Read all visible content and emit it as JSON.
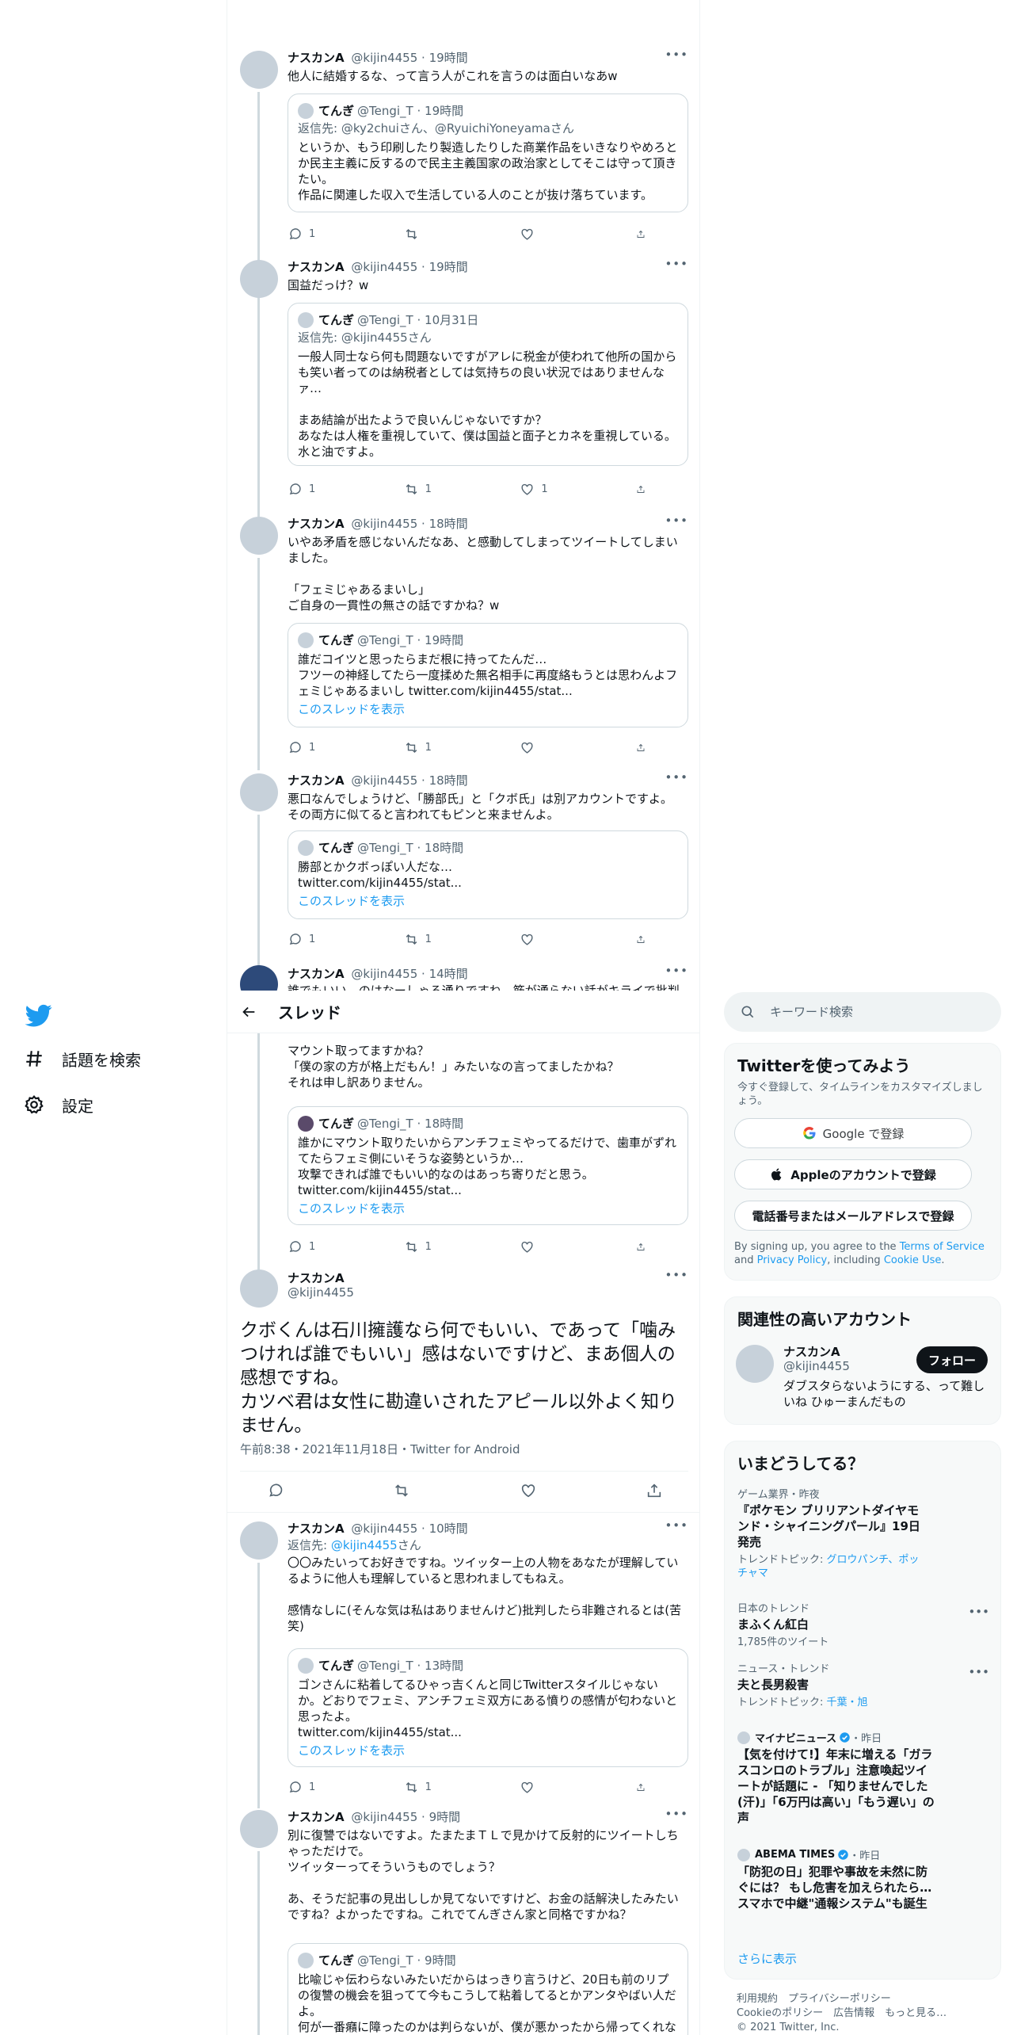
{
  "nav": {
    "explore": "話題を検索",
    "settings": "設定"
  },
  "header": {
    "title": "スレッド"
  },
  "tweets_top": [
    {
      "name": "ナスカンA",
      "handle": "@kijin4455",
      "time": "19時間",
      "text": "他人に結婚するな、って言う人がこれを言うのは面白いなあw",
      "quote": {
        "name": "てんぎ",
        "handle": "@Tengi_T",
        "time": "19時間",
        "reply": "返信先: @ky2chuiさん、@RyuichiYoneyamaさん",
        "text": "というか、もう印刷したり製造したりした商業作品をいきなりやめろとか民主主義に反するので民主主義国家の政治家としてそこは守って頂きたい。\n作品に関連した収入で生活している人のことが抜け落ちています。",
        "thread": ""
      },
      "counts": {
        "reply": "1",
        "retweet": "",
        "like": ""
      }
    },
    {
      "name": "ナスカンA",
      "handle": "@kijin4455",
      "time": "19時間",
      "text": "国益だっけ？w",
      "quote": {
        "name": "てんぎ",
        "handle": "@Tengi_T",
        "time": "10月31日",
        "reply": "返信先: @kijin4455さん",
        "text": "一般人同士なら何も問題ないですがアレに税金が使われて他所の国からも笑い者ってのは納税者としては気持ちの良い状況ではありませんなァ…\n\nまあ結論が出たようで良いんじゃないですか？\nあなたは人権を重視していて、僕は国益と面子とカネを重視している。\n水と油ですよ。",
        "thread": ""
      },
      "counts": {
        "reply": "1",
        "retweet": "1",
        "like": "1"
      }
    },
    {
      "name": "ナスカンA",
      "handle": "@kijin4455",
      "time": "18時間",
      "text": "いやあ矛盾を感じないんだなあ、と感動してしまってツイートしてしまいました。\n\n「フェミじゃあるまいし」\nご自身の一貫性の無さの話ですかね？w",
      "quote": {
        "name": "てんぎ",
        "handle": "@Tengi_T",
        "time": "19時間",
        "reply": "",
        "text": "誰だコイツと思ったらまだ根に持ってたんだ…\nフツーの神経してたら一度揉めた無名相手に再度絡もうとは思わんよフェミじゃあるまいし twitter.com/kijin4455/stat...",
        "thread": "このスレッドを表示"
      },
      "counts": {
        "reply": "1",
        "retweet": "1",
        "like": ""
      }
    },
    {
      "name": "ナスカンA",
      "handle": "@kijin4455",
      "time": "18時間",
      "text": "悪口なんでしょうけど、「勝部氏」と「クボ氏」は別アカウントですよ。\nその両方に似てると言われてもピンと来ませんよ。",
      "quote": {
        "name": "てんぎ",
        "handle": "@Tengi_T",
        "time": "18時間",
        "reply": "",
        "text": "勝部とかクボっぽい人だな…\ntwitter.com/kijin4455/stat...",
        "thread": "このスレッドを表示"
      },
      "counts": {
        "reply": "1",
        "retweet": "1",
        "like": ""
      }
    },
    {
      "name": "ナスカンA",
      "handle": "@kijin4455",
      "time": "14時間",
      "text": "誰でもいい、のはなーしゃる通りですね。筋が通らない話がキライで批判"
    }
  ],
  "tweet_partial": {
    "text": "マウント取ってますかね？\n「僕の家の方が格上だもん！」みたいなの言ってましたかね？\nそれは申し訳ありません。",
    "quote": {
      "name": "てんぎ",
      "handle": "@Tengi_T",
      "time": "18時間",
      "text": "誰かにマウント取りたいからアンチフェミやってるだけで、歯車がずれてたらフェミ側にいそうな姿勢というか…\n攻撃できれば誰でもいい的なのはあっち寄りだと思う。\ntwitter.com/kijin4455/stat...",
      "thread": "このスレッドを表示"
    },
    "counts": {
      "reply": "1",
      "retweet": "1",
      "like": ""
    }
  },
  "main_tweet": {
    "name": "ナスカンA",
    "handle": "@kijin4455",
    "text": "クボくんは石川擁護なら何でもいい、であって「噛みつければ誰でもいい」感はないですけど、まあ個人の感想ですね。\nカツベ君は女性に勘違いされたアピール以外よく知りません。",
    "meta": "午前8:38・2021年11月18日・Twitter for Android"
  },
  "tweets_bottom": [
    {
      "name": "ナスカンA",
      "handle": "@kijin4455",
      "time": "10時間",
      "reply_prefix": "返信先: ",
      "reply_to": "@kijin4455",
      "reply_suffix": "さん",
      "text": "〇〇みたいってお好きですね。ツイッター上の人物をあなたが理解しているように他人も理解していると思われましてもねえ。\n\n感情なしに(そんな気は私はありませんけど)批判したら非難されるとは(苦笑)",
      "quote": {
        "name": "てんぎ",
        "handle": "@Tengi_T",
        "time": "13時間",
        "text": "ゴンさんに粘着してるひゃっ吉くんと同じTwitterスタイルじゃないか。どおりでフェミ、アンチフェミ双方にある憤りの感情が匂わないと思ったよ。\ntwitter.com/kijin4455/stat...",
        "thread": "このスレッドを表示"
      },
      "counts": {
        "reply": "1",
        "retweet": "1",
        "like": ""
      }
    },
    {
      "name": "ナスカンA",
      "handle": "@kijin4455",
      "time": "9時間",
      "text": "別に復讐ではないですよ。たまたまＴＬで見かけて反射的にツイートしちゃっただけで。\nツイッターってそういうものでしょう？\n\nあ、そうだ記事の見出ししか見てないですけど、お金の話解決したみたいですね？よかったですね。これでてんぎさん家と同格ですかね？",
      "quote": {
        "name": "てんぎ",
        "handle": "@Tengi_T",
        "time": "9時間",
        "text": "比喩じゃ伝わらないみたいだからはっきり言うけど、20日も前のリプの復讐の機会を狙ってて今もこうして粘着してるとかアンタやばい人だよ。\n何が一番癪に障ったのかは判らないが、僕が悪かったから帰ってくれないか。"
      }
    }
  ],
  "right": {
    "search_placeholder": "キーワード検索",
    "signup": {
      "title": "Twitterを使ってみよう",
      "desc": "今すぐ登録して、タイムラインをカスタマイズしましょう。",
      "google": "Google で登録",
      "apple": "Appleのアカウントで登録",
      "phone": "電話番号またはメールアドレスで登録",
      "legal_1": "By signing up, you agree to the ",
      "tos": "Terms of Service",
      "legal_2": " and ",
      "privacy": "Privacy Policy",
      "legal_3": ", including ",
      "cookie": "Cookie Use",
      "legal_4": "."
    },
    "related": {
      "title": "関連性の高いアカウント",
      "name": "ナスカンA",
      "handle": "@kijin4455",
      "follow": "フォロー",
      "bio": "ダブスタらないようにする、って難しいね ひゅーまんだもの"
    },
    "trends": {
      "title": "いまどうしてる？",
      "items": [
        {
          "ctx": "ゲーム業界・昨夜",
          "title": "『ポケモン ブリリアントダイヤモンド・シャイニングパール』19日発売",
          "sub_prefix": "トレンドトピック: ",
          "sub_links": "グロウパンチ、ポッチャマ"
        },
        {
          "ctx": "日本のトレンド",
          "title": "まふくん紅白",
          "sub": "1,785件のツイート"
        },
        {
          "ctx": "ニュース・トレンド",
          "title": "夫と長男殺害",
          "sub_prefix": "トレンドトピック: ",
          "sub_links": "千葉・旭"
        },
        {
          "source": "マイナビニュース",
          "time": "・昨日",
          "title": "【気を付けて!】年末に増える「ガラスコンロのトラブル」注意喚起ツイートが話題に - 「知りませんでした(汗)」「6万円は高い」「もう遅い」の声"
        },
        {
          "source": "ABEMA TIMES",
          "time": "・昨日",
          "title": "「防犯の日」犯罪や事故を未然に防ぐには？ もし危害を加えられたら…スマホで中継\"通報システム\"も誕生"
        }
      ],
      "more": "さらに表示"
    },
    "footer": {
      "line1": "利用規約　プライバシーポリシー",
      "line2": "Cookieのポリシー　広告情報　もっと見る…",
      "line3": "© 2021 Twitter, Inc."
    }
  },
  "colors": {
    "accent": "#1d9bf0",
    "text": "#0f1419",
    "muted": "#536471"
  }
}
